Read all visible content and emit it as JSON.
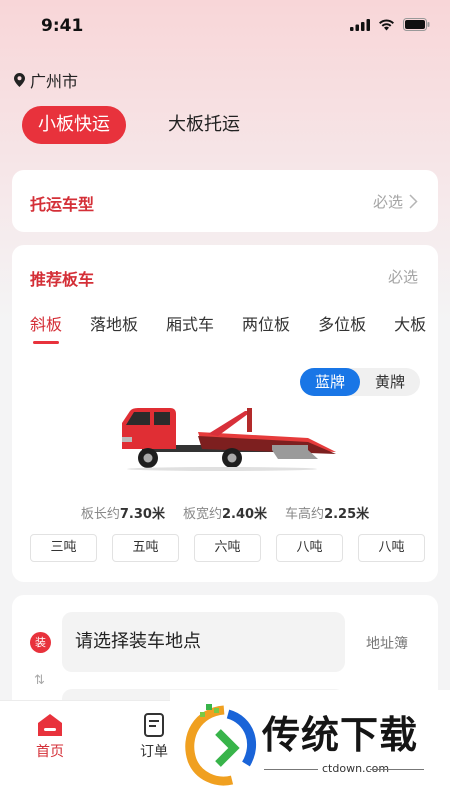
{
  "status": {
    "time": "9:41"
  },
  "location": {
    "city": "广州市"
  },
  "mode_tabs": [
    {
      "label": "小板快运",
      "active": true
    },
    {
      "label": "大板托运",
      "active": false
    }
  ],
  "vehicle_type": {
    "title": "托运车型",
    "hint": "必选"
  },
  "recommend": {
    "title": "推荐板车",
    "hint": "必选",
    "tabs": [
      "斜板",
      "落地板",
      "厢式车",
      "两位板",
      "多位板",
      "大板"
    ],
    "plate_options": [
      "蓝牌",
      "黄牌"
    ],
    "specs": [
      {
        "label": "板长约",
        "value": "7.30米"
      },
      {
        "label": "板宽约",
        "value": "2.40米"
      },
      {
        "label": "车高约",
        "value": "2.25米"
      }
    ],
    "tonnage": [
      "三吨",
      "五吨",
      "六吨",
      "八吨",
      "八吨"
    ]
  },
  "address": {
    "badge": "装",
    "load_placeholder": "请选择装车地点",
    "address_book": "地址簿",
    "swap": "⇅"
  },
  "nav": {
    "home": "首页",
    "orders": "订单"
  },
  "watermark": {
    "name": "传统下载",
    "url": "ctdown.com"
  },
  "colors": {
    "accent": "#e8323c",
    "blue_plate": "#1976e6"
  }
}
